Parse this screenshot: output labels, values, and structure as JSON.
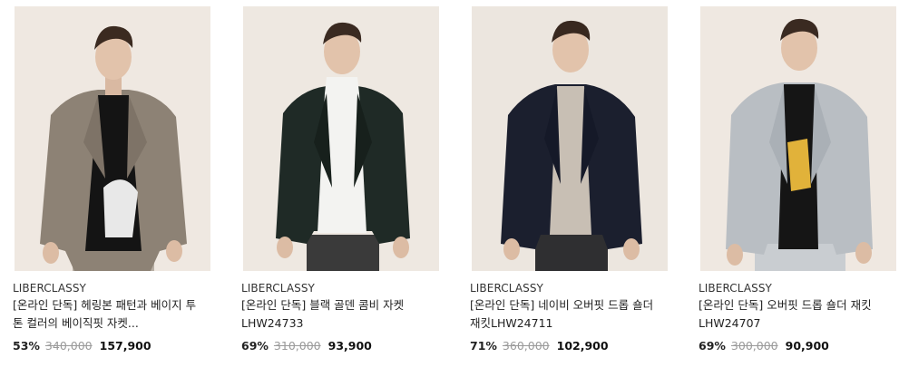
{
  "products": [
    {
      "brand": "LIBERCLASSY",
      "name": "[온라인 단독] 헤링본 패턴과 베이지 투톤 컬러의 베이직핏 자켓...",
      "discount": "53%",
      "original_price": "340,000",
      "sale_price": "157,900",
      "image": "model-beige-herringbone-jacket"
    },
    {
      "brand": "LIBERCLASSY",
      "name": "[온라인 단독] 블랙 골덴 콤비 자켓 LHW24733",
      "discount": "69%",
      "original_price": "310,000",
      "sale_price": "93,900",
      "image": "model-black-corduroy-jacket"
    },
    {
      "brand": "LIBERCLASSY",
      "name": "[온라인 단독] 네이비 오버핏 드롭 숄더 재킷LHW24711",
      "discount": "71%",
      "original_price": "360,000",
      "sale_price": "102,900",
      "image": "model-navy-overfit-jacket"
    },
    {
      "brand": "LIBERCLASSY",
      "name": "[온라인 단독] 오버핏 드롭 숄더 재킷LHW24707",
      "discount": "69%",
      "original_price": "300,000",
      "sale_price": "90,900",
      "image": "model-lightgray-overfit-jacket"
    }
  ],
  "colors": {
    "background": "#ffffff",
    "photo_bg": "#efe9e2",
    "discount": "#222222",
    "original_price": "#9a9a9a",
    "sale_price": "#111111"
  }
}
